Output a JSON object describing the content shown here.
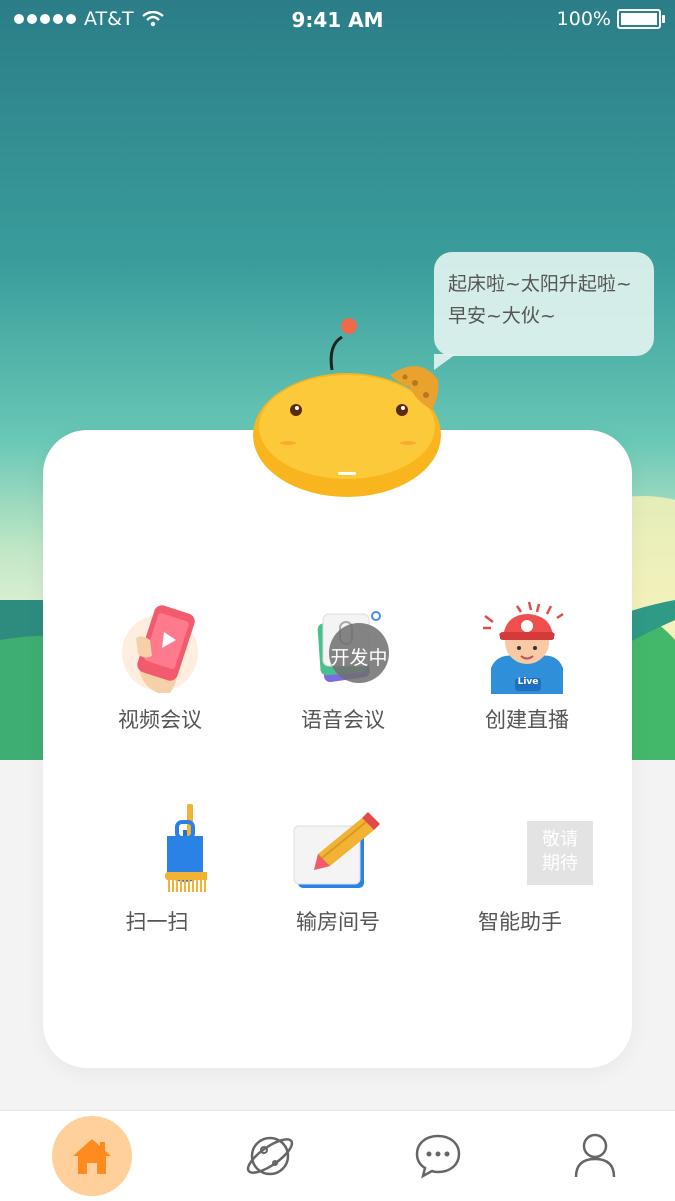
{
  "status_bar": {
    "carrier": "AT&T",
    "time": "9:41 AM",
    "battery": "100%"
  },
  "bubble": {
    "line1": "起床啦~太阳升起啦~",
    "line2": "早安~大伙~"
  },
  "grid": [
    {
      "label": "视频会议",
      "icon": "video-phone-icon"
    },
    {
      "label": "语音会议",
      "icon": "voice-cards-icon",
      "badge": "开发中"
    },
    {
      "label": "创建直播",
      "icon": "live-boy-icon",
      "tag": "Live"
    },
    {
      "label": "扫一扫",
      "icon": "broom-dustpan-icon"
    },
    {
      "label": "输房间号",
      "icon": "pencil-pad-icon"
    },
    {
      "label": "智能助手",
      "icon": "coming-soon-icon",
      "placeholder": "敬请\n期待"
    }
  ],
  "tabs": [
    {
      "name": "home",
      "icon": "home-icon",
      "active": true
    },
    {
      "name": "discover",
      "icon": "planet-icon",
      "active": false
    },
    {
      "name": "messages",
      "icon": "chat-icon",
      "active": false
    },
    {
      "name": "profile",
      "icon": "user-icon",
      "active": false
    }
  ],
  "colors": {
    "accent": "#ff8a1f",
    "accent_light": "#ffcf9c",
    "mascot": "#f8b51d"
  }
}
